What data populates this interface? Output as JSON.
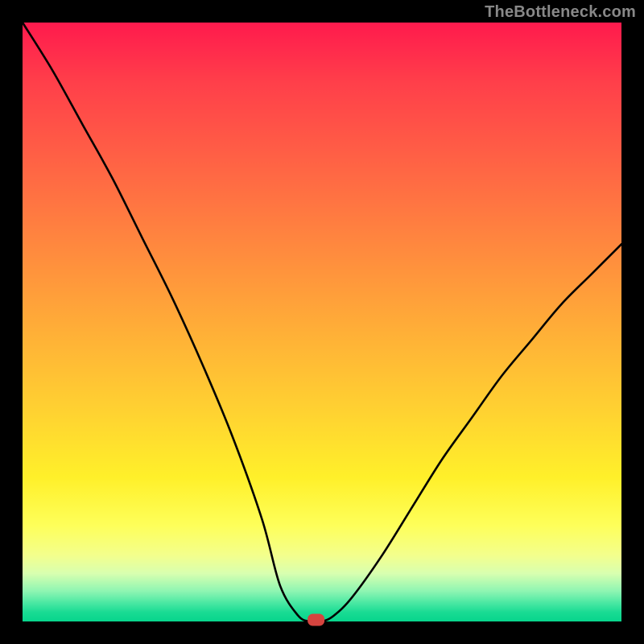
{
  "watermark": {
    "text": "TheBottleneck.com"
  },
  "chart_data": {
    "type": "line",
    "title": "",
    "xlabel": "",
    "ylabel": "",
    "xlim": [
      0,
      100
    ],
    "ylim": [
      0,
      100
    ],
    "series": [
      {
        "name": "bottleneck-curve",
        "x": [
          0,
          5,
          10,
          15,
          20,
          25,
          30,
          35,
          40,
          43,
          46,
          48,
          50,
          52,
          55,
          60,
          65,
          70,
          75,
          80,
          85,
          90,
          95,
          100
        ],
        "values": [
          100,
          92,
          83,
          74,
          64,
          54,
          43,
          31,
          17,
          6,
          1,
          0,
          0,
          1,
          4,
          11,
          19,
          27,
          34,
          41,
          47,
          53,
          58,
          63
        ]
      }
    ],
    "marker": {
      "x": 49,
      "y": 0,
      "shape": "rounded-rect",
      "color": "#d5443f"
    }
  }
}
